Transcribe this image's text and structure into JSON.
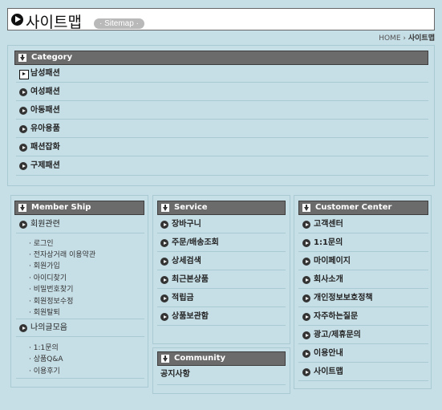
{
  "title": {
    "text": "사이트맵",
    "pill": "· Sitemap ·"
  },
  "breadcrumb": {
    "home": "HOME",
    "separator": "›",
    "current": "사이트맵"
  },
  "category": {
    "header": "Category",
    "items": [
      "남성패션",
      "여성패션",
      "아동패션",
      "유아용품",
      "패션잡화",
      "구제패션"
    ]
  },
  "member": {
    "header": "Member Ship",
    "group1": "회원관련",
    "group1_items": [
      "· 로그인",
      "· 전자상거래 이용약관",
      "· 회원가입",
      "· 아이디찾기",
      "· 비밀번호찾기",
      "· 회원정보수정",
      "· 회원탈퇴"
    ],
    "group2": "나의글모음",
    "group2_items": [
      "· 1:1문의",
      "· 상품Q&A",
      "· 이용후기"
    ]
  },
  "service": {
    "header": "Service",
    "items": [
      "장바구니",
      "주문/배송조회",
      "상세검색",
      "최근본상품",
      "적립금",
      "상품보관함"
    ]
  },
  "community": {
    "header": "Community",
    "items": [
      "공지사항"
    ]
  },
  "customer": {
    "header": "Customer Center",
    "items": [
      "고객센터",
      "1:1문의",
      "마이페이지",
      "회사소개",
      "개인정보보호정책",
      "자주하는질문",
      "광고/제휴문의",
      "이용안내",
      "사이트맵"
    ]
  }
}
